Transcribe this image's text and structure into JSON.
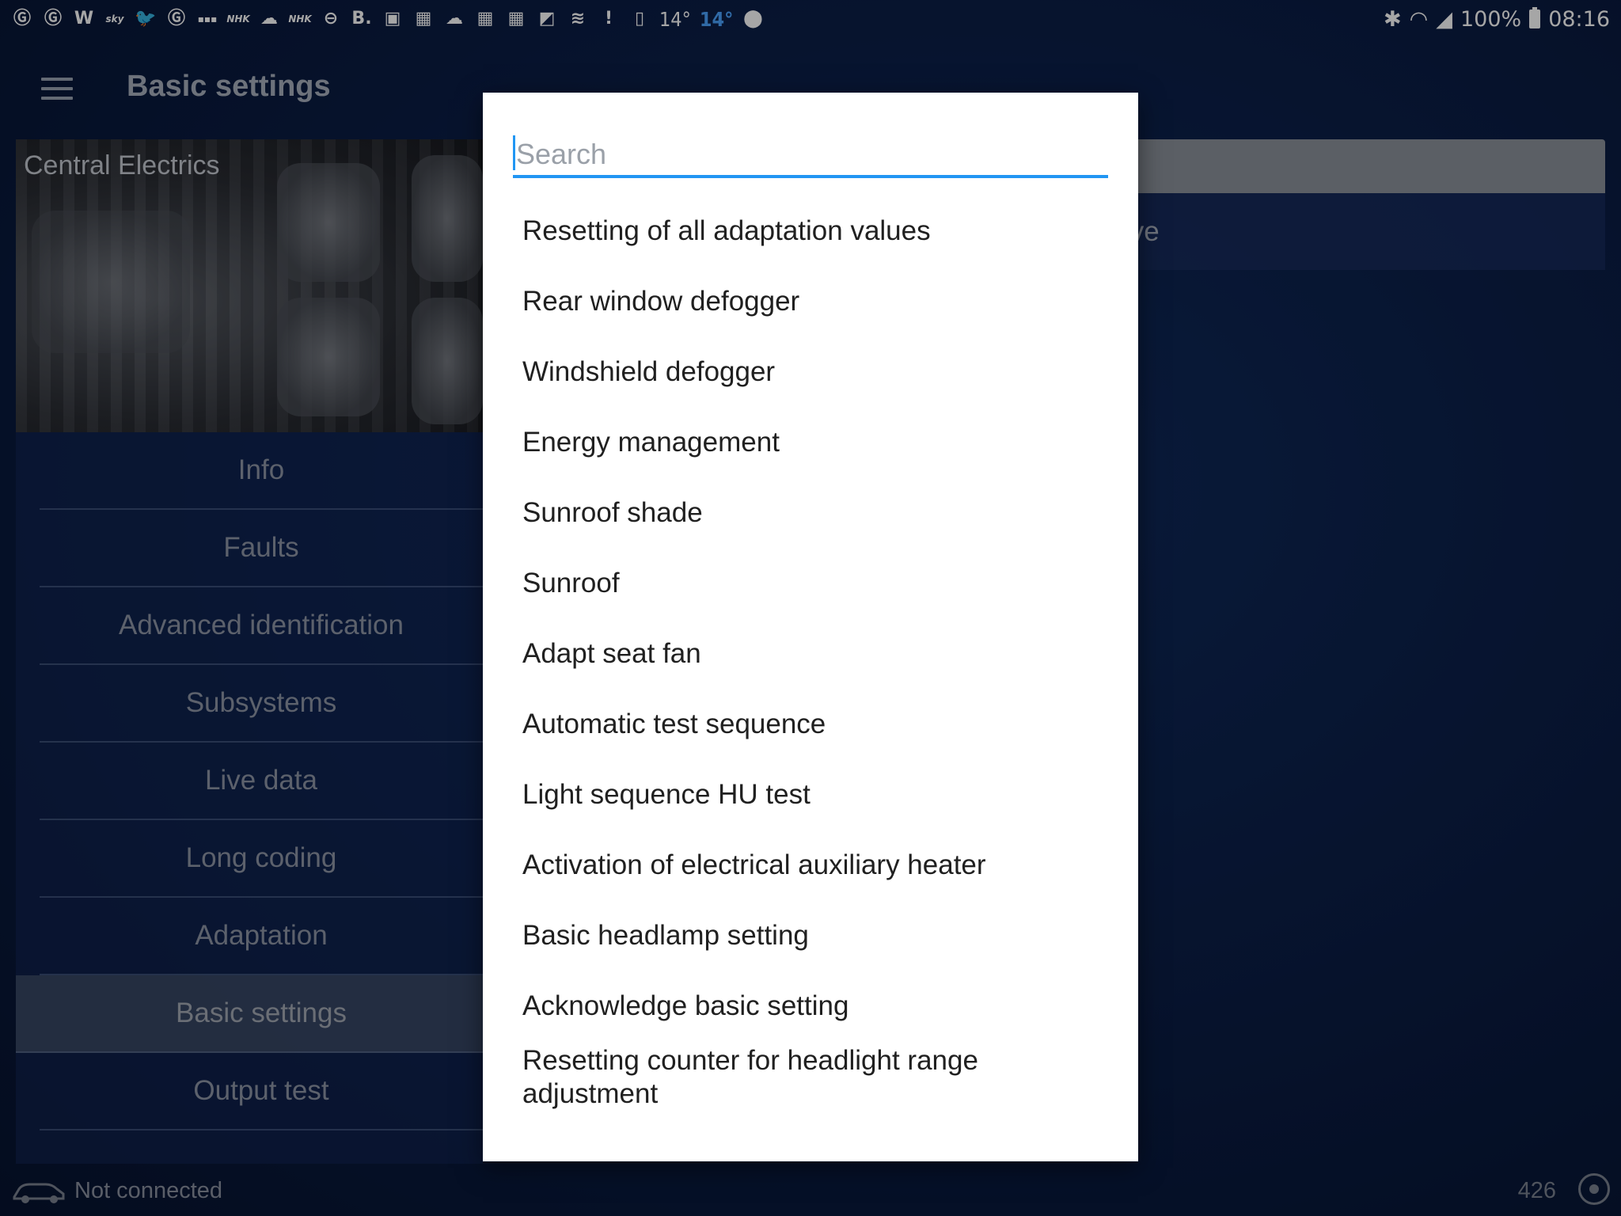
{
  "status_bar": {
    "left_icons": [
      "g-icon",
      "g-icon",
      "w-icon",
      "sky-news-icon",
      "twitter-icon",
      "g-icon",
      "bbc-news-icon",
      "nhk-world-icon",
      "cloud-download-icon",
      "nhk-world-icon",
      "minus-circle-icon",
      "b-icon",
      "image-icon",
      "calendar-icon",
      "cloud-icon",
      "calendar-icon",
      "calendar-icon",
      "flipboard-icon",
      "layers-icon",
      "alert-icon",
      "document-icon"
    ],
    "temp1": "14°",
    "temp2": "14°",
    "battery": "100%",
    "time": "08:16"
  },
  "app_bar": {
    "title": "Basic settings"
  },
  "left_panel": {
    "module_title": "Central Electrics",
    "menu": [
      "Info",
      "Faults",
      "Advanced identification",
      "Subsystems",
      "Live data",
      "Long coding",
      "Adaptation",
      "Basic settings",
      "Output test"
    ],
    "active_index": 7
  },
  "right_panel": {
    "row_text": "ive"
  },
  "footer": {
    "status": "Not connected",
    "count": "426"
  },
  "dialog": {
    "search_placeholder": "Search",
    "options": [
      "Resetting of all adaptation values",
      "Rear window defogger",
      "Windshield defogger",
      "Energy management",
      "Sunroof shade",
      "Sunroof",
      "Adapt seat fan",
      "Automatic test sequence",
      "Light sequence HU test",
      "Activation of electrical auxiliary heater",
      "Basic headlamp setting",
      "Acknowledge basic setting",
      "Resetting counter for headlight range adjustment"
    ]
  },
  "colors": {
    "accent": "#2196f3",
    "background": "#0b1f48",
    "dialog": "#ffffff"
  }
}
